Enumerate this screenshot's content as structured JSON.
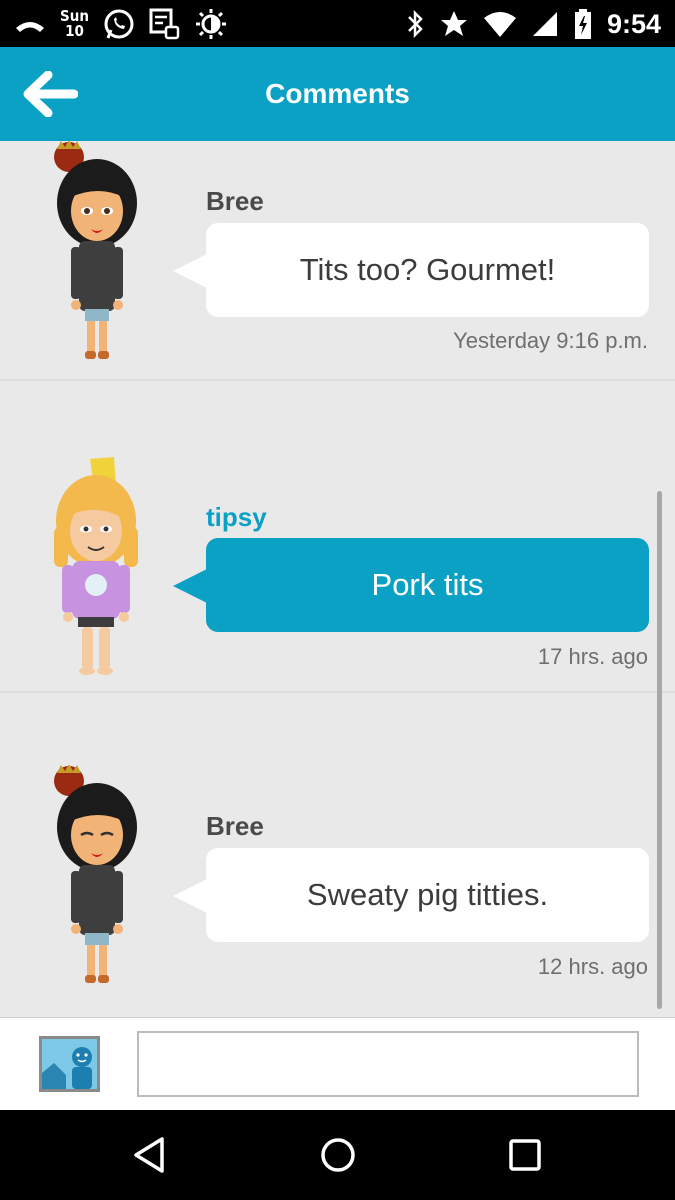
{
  "status_bar": {
    "date_day": "Sun",
    "date_num": "10",
    "time": "9:54",
    "icons_left": [
      "missed-call-icon",
      "whatsapp-icon",
      "clipboard-icon",
      "brightness-icon"
    ],
    "icons_right": [
      "bluetooth-icon",
      "star-icon",
      "wifi-icon",
      "signal-icon",
      "battery-charging-icon"
    ]
  },
  "app_bar": {
    "title": "Comments",
    "back_icon": "arrow-back-icon",
    "color": "#0aa1c5"
  },
  "comments": [
    {
      "author": "Bree",
      "text": "Tits too? Gourmet!",
      "timestamp": "Yesterday 9:16 p.m.",
      "highlight": false,
      "avatar": "mii-bree-crown-avatar"
    },
    {
      "author": "tipsy",
      "text": "Pork tits",
      "timestamp": "17 hrs. ago",
      "highlight": true,
      "avatar": "mii-tipsy-avatar"
    },
    {
      "author": "Bree",
      "text": "Sweaty pig titties.",
      "timestamp": "12 hrs. ago",
      "highlight": false,
      "avatar": "mii-bree-crown-avatar"
    }
  ],
  "colors": {
    "author_default": "#4a4a4a",
    "author_highlight": "#0aa1c5",
    "bubble_white": "#ffffff",
    "bubble_blue": "#0aa1c5"
  },
  "input_bar": {
    "image_button_icon": "image-icon",
    "input_value": "",
    "input_placeholder": ""
  },
  "nav_bar": {
    "buttons": [
      "back-triangle-icon",
      "home-circle-icon",
      "recents-square-icon"
    ]
  }
}
